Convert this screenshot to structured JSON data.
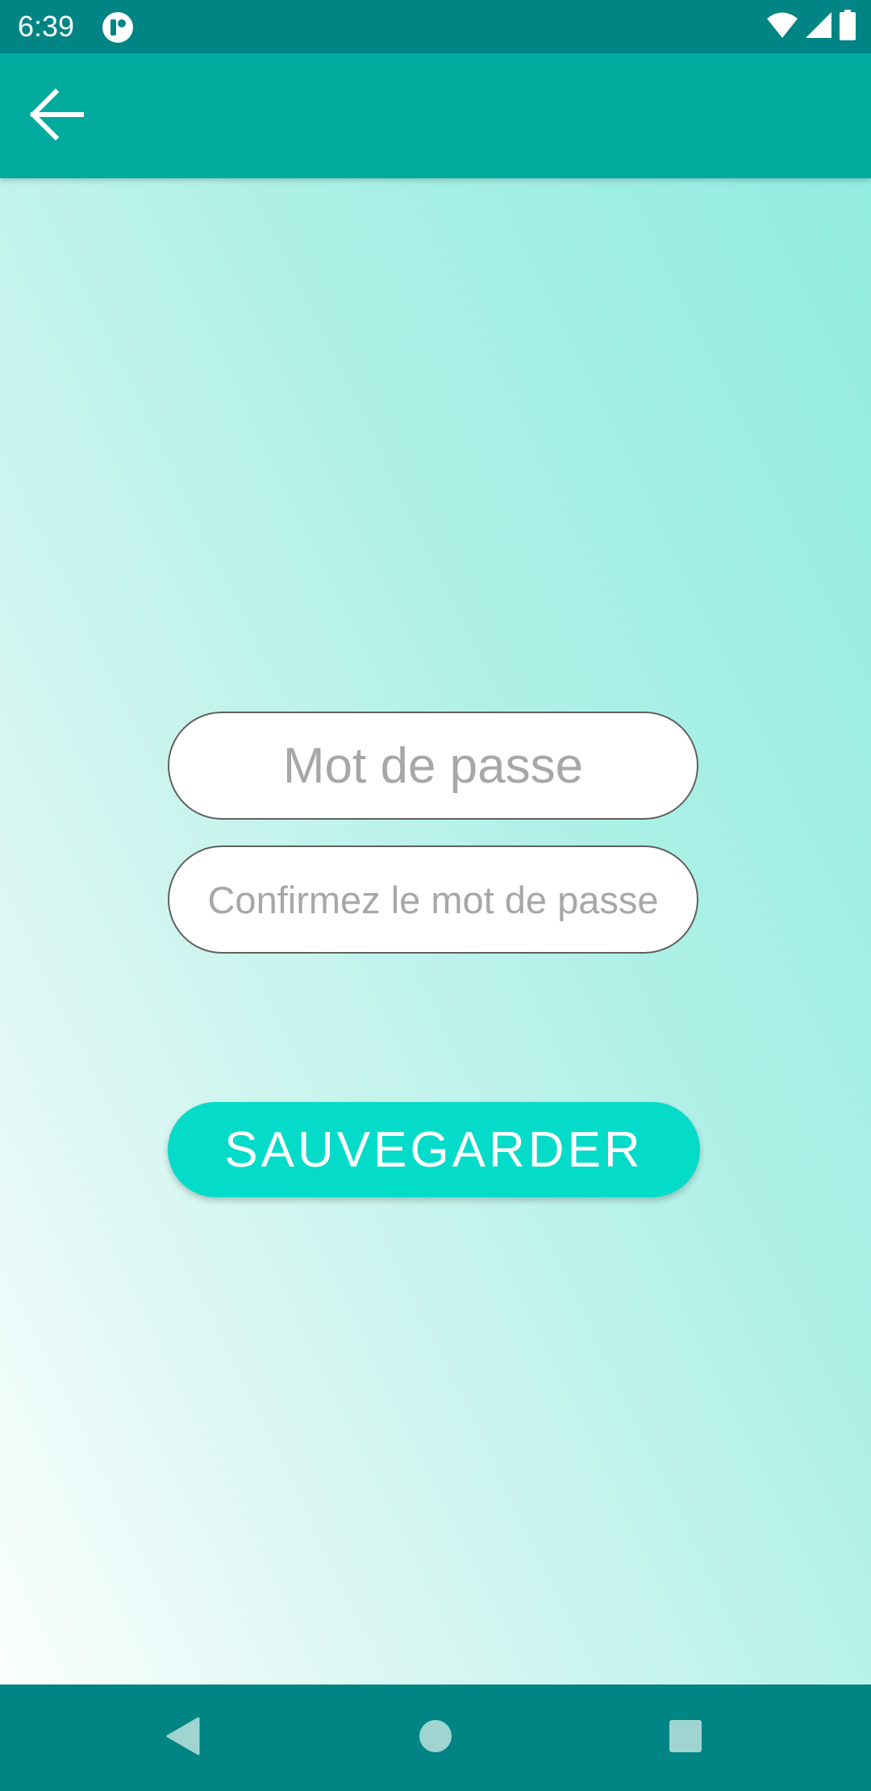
{
  "status_bar": {
    "time": "6:39",
    "app_icon": "app-notification-icon",
    "icons": [
      "wifi-icon",
      "cellular-signal-icon",
      "battery-icon"
    ]
  },
  "app_bar": {
    "back_icon": "arrow-back-icon"
  },
  "form": {
    "password_placeholder": "Mot de passe",
    "password_value": "",
    "confirm_placeholder": "Confirmez le mot de passe",
    "confirm_value": "",
    "save_label": "SAUVEGARDER"
  },
  "nav_bar": {
    "icons": [
      "nav-back-icon",
      "nav-home-icon",
      "nav-recents-icon"
    ]
  },
  "colors": {
    "status_bar": "#008484",
    "app_bar": "#00ab9e",
    "accent_button": "#05dbc9",
    "nav_bar": "#008484",
    "placeholder_text": "#a7a7a7"
  }
}
